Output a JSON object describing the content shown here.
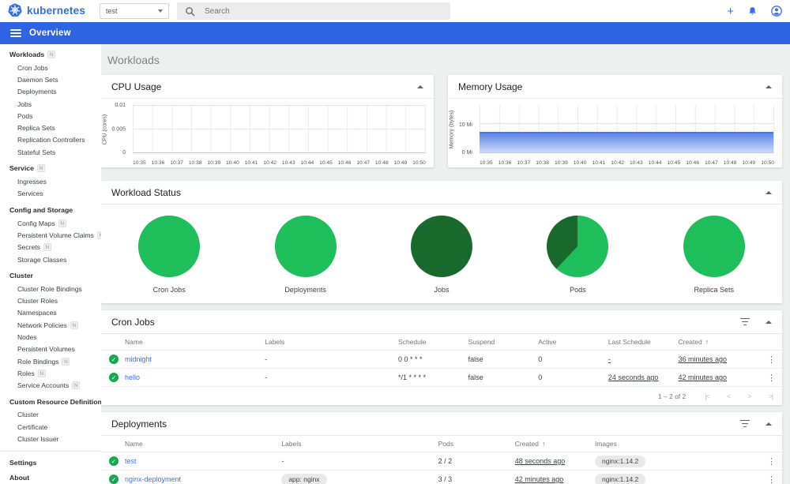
{
  "icons": {
    "add": "+",
    "check": "✓",
    "more": "⋮",
    "sort_asc": "↑",
    "first_page": "|<",
    "prev_page": "<",
    "next_page": ">",
    "last_page": ">|"
  },
  "header": {
    "logo_text": "kubernetes",
    "namespace_value": "test",
    "search_placeholder": "Search"
  },
  "toolbar": {
    "title": "Overview"
  },
  "sidebar": {
    "groups": [
      {
        "label": "Workloads",
        "badge": "N",
        "items": [
          {
            "label": "Cron Jobs"
          },
          {
            "label": "Daemon Sets"
          },
          {
            "label": "Deployments"
          },
          {
            "label": "Jobs"
          },
          {
            "label": "Pods"
          },
          {
            "label": "Replica Sets"
          },
          {
            "label": "Replication Controllers"
          },
          {
            "label": "Stateful Sets"
          }
        ]
      },
      {
        "label": "Service",
        "badge": "N",
        "items": [
          {
            "label": "Ingresses"
          },
          {
            "label": "Services"
          }
        ]
      },
      {
        "label": "Config and Storage",
        "badge": "",
        "items": [
          {
            "label": "Config Maps",
            "badge": "N"
          },
          {
            "label": "Persistent Volume Claims",
            "badge": "N"
          },
          {
            "label": "Secrets",
            "badge": "N"
          },
          {
            "label": "Storage Classes"
          }
        ]
      },
      {
        "label": "Cluster",
        "badge": "",
        "items": [
          {
            "label": "Cluster Role Bindings"
          },
          {
            "label": "Cluster Roles"
          },
          {
            "label": "Namespaces"
          },
          {
            "label": "Network Policies",
            "badge": "N"
          },
          {
            "label": "Nodes"
          },
          {
            "label": "Persistent Volumes"
          },
          {
            "label": "Role Bindings",
            "badge": "N"
          },
          {
            "label": "Roles",
            "badge": "N"
          },
          {
            "label": "Service Accounts",
            "badge": "N"
          }
        ]
      },
      {
        "label": "Custom Resource Definitions",
        "badge": "",
        "items": [
          {
            "label": "Cluster"
          },
          {
            "label": "Certificate"
          },
          {
            "label": "Cluster Issuer"
          }
        ]
      }
    ],
    "footer_items": [
      {
        "label": "Settings"
      },
      {
        "label": "About"
      }
    ]
  },
  "page": {
    "title": "Workloads"
  },
  "cards": {
    "cpu": {
      "title": "CPU Usage"
    },
    "memory": {
      "title": "Memory Usage"
    },
    "status": {
      "title": "Workload Status"
    },
    "cron_jobs": {
      "title": "Cron Jobs",
      "columns": [
        "Name",
        "Labels",
        "Schedule",
        "Suspend",
        "Active",
        "Last Schedule",
        "Created"
      ],
      "rows": [
        {
          "name": "midnight",
          "labels": "-",
          "schedule": "0 0 * * *",
          "suspend": "false",
          "active": "0",
          "last_schedule": "-",
          "created": "36 minutes ago"
        },
        {
          "name": "hello",
          "labels": "-",
          "schedule": "*/1 * * * *",
          "suspend": "false",
          "active": "0",
          "last_schedule": "24 seconds ago",
          "created": "42 minutes ago"
        }
      ],
      "pagination_text": "1 – 2 of 2"
    },
    "deployments": {
      "title": "Deployments",
      "columns": [
        "Name",
        "Labels",
        "Pods",
        "Created",
        "Images"
      ],
      "rows": [
        {
          "name": "test",
          "labels_text": "-",
          "labels_chip": "",
          "pods": "2 / 2",
          "created": "48 seconds ago",
          "image": "nginx:1.14.2"
        },
        {
          "name": "nginx-deployment",
          "labels_text": "",
          "labels_chip": "app: nginx",
          "pods": "3 / 3",
          "created": "42 minutes ago",
          "image": "nginx:1.14.2"
        }
      ]
    }
  },
  "chart_data": [
    {
      "type": "line",
      "title": "CPU Usage",
      "xlabel": "",
      "ylabel": "CPU (cores)",
      "x": [
        "10:35",
        "10:36",
        "10:37",
        "10:38",
        "10:39",
        "10:40",
        "10:41",
        "10:42",
        "10:43",
        "10:44",
        "10:45",
        "10:46",
        "10:47",
        "10:48",
        "10:49",
        "10:50"
      ],
      "yticks": [
        "0",
        "0.005",
        "0.01"
      ],
      "ylim": [
        0,
        0.01
      ],
      "grid": true,
      "series": []
    },
    {
      "type": "area",
      "title": "Memory Usage",
      "xlabel": "",
      "ylabel": "Memory (bytes)",
      "x": [
        "10:35",
        "10:36",
        "10:37",
        "10:38",
        "10:39",
        "10:40",
        "10:41",
        "10:42",
        "10:43",
        "10:44",
        "10:45",
        "10:46",
        "10:47",
        "10:48",
        "10:49",
        "10:50"
      ],
      "yticks": [
        "0 Mi",
        "10 Mi"
      ],
      "ylim": [
        0,
        16.8
      ],
      "unit": "Mi",
      "grid": true,
      "series": [
        {
          "name": "Memory usage",
          "values": [
            7.2,
            7.2,
            7.2,
            7.2,
            7.2,
            7.2,
            7.2,
            7.2,
            7.2,
            7.2,
            7.2,
            7.2,
            7.2,
            7.2,
            7.2,
            7.2
          ]
        }
      ],
      "area_color_top": "#5d86e8",
      "area_color_bottom": "#ccd8f7"
    },
    {
      "type": "pie",
      "title": "Workload Status",
      "colors": {
        "running_green": "#1ebe5a",
        "succeeded_dark_green": "#17692c"
      },
      "pies": [
        {
          "label": "Cron Jobs",
          "segments": [
            {
              "color": "#1ebe5a",
              "pct": 100
            }
          ]
        },
        {
          "label": "Deployments",
          "segments": [
            {
              "color": "#1ebe5a",
              "pct": 100
            }
          ]
        },
        {
          "label": "Jobs",
          "segments": [
            {
              "color": "#17692c",
              "pct": 100
            }
          ]
        },
        {
          "label": "Pods",
          "segments": [
            {
              "color": "#1ebe5a",
              "pct": 62
            },
            {
              "color": "#17692c",
              "pct": 38
            }
          ]
        },
        {
          "label": "Replica Sets",
          "segments": [
            {
              "color": "#1ebe5a",
              "pct": 100
            }
          ]
        }
      ]
    }
  ]
}
